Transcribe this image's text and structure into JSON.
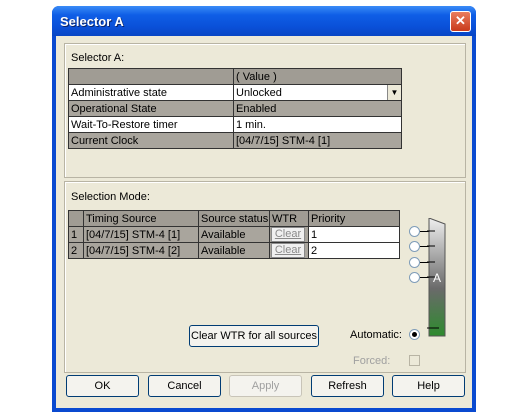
{
  "window": {
    "title": "Selector A"
  },
  "group1": {
    "label": "Selector A:",
    "value_header": "( Value )",
    "rows": [
      {
        "name": "Administrative state",
        "value": "Unlocked"
      },
      {
        "name": "Operational State",
        "value": "Enabled"
      },
      {
        "name": "Wait-To-Restore timer",
        "value": "1 min."
      },
      {
        "name": "Current Clock",
        "value": "[04/7/15] STM-4 [1]"
      }
    ]
  },
  "group2": {
    "label": "Selection Mode:",
    "columns": [
      "Timing Source",
      "Source status",
      "WTR",
      "Priority"
    ],
    "rows": [
      {
        "num": "1",
        "source": "[04/7/15] STM-4 [1]",
        "status": "Available",
        "wtr": "Clear",
        "priority": "1"
      },
      {
        "num": "2",
        "source": "[04/7/15] STM-4 [2]",
        "status": "Available",
        "wtr": "Clear",
        "priority": "2"
      }
    ],
    "clear_all": "Clear WTR for all sources",
    "automatic_label": "Automatic:",
    "forced_label": "Forced:",
    "switch_label": "A"
  },
  "buttons": {
    "ok": "OK",
    "cancel": "Cancel",
    "apply": "Apply",
    "refresh": "Refresh",
    "help": "Help"
  },
  "colors": {
    "titlebar": "#0a50d8",
    "client": "#ece9d8",
    "switch_green": "#2e8b2e"
  }
}
